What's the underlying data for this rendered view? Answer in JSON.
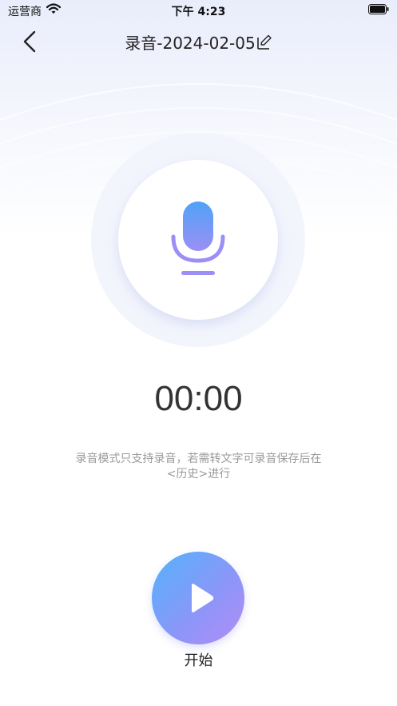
{
  "status_bar": {
    "carrier": "运营商",
    "time": "下午 4:23",
    "wifi_icon": "wifi-icon",
    "battery_icon": "battery-icon"
  },
  "nav": {
    "back_icon": "chevron-left-icon",
    "title": "录音-2024-02-05",
    "edit_icon": "edit-icon"
  },
  "recorder": {
    "mic_icon": "microphone-icon",
    "timer": "00:00",
    "hint": "录音模式只支持录音，若需转文字可录音保存后在<历史>进行"
  },
  "start": {
    "play_icon": "play-icon",
    "label": "开始"
  },
  "colors": {
    "accent_start": "#54b2fb",
    "accent_end": "#b48cf5",
    "hint_text": "#9a9a9a"
  }
}
